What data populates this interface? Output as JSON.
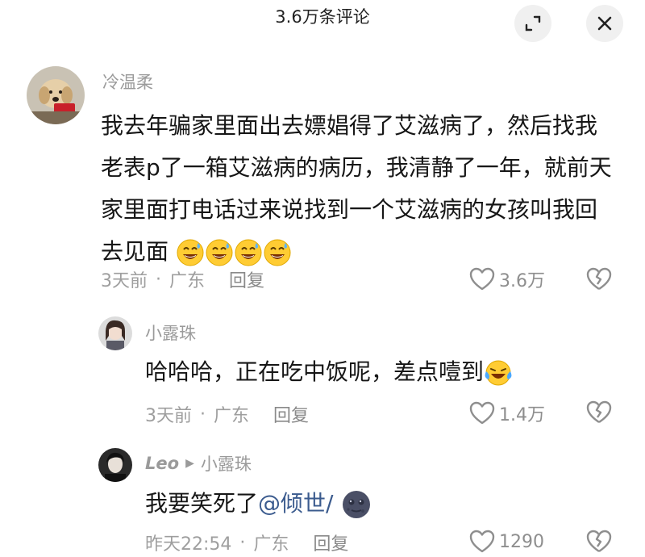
{
  "header": {
    "title": "3.6万条评论",
    "expand_icon": "expand-icon",
    "close_icon": "close-icon"
  },
  "comments": [
    {
      "username": "冷温柔",
      "text": "我去年骗家里面出去嫖娼得了艾滋病了，然后找我老表p了一箱艾滋病的病历，我清静了一年，就前天家里面打电话过来说找到一个艾滋病的女孩叫我回去见面",
      "emoji": "grinning-sweat-emoji x4",
      "time": "3天前",
      "dot": "·",
      "location": "广东",
      "reply_label": "回复",
      "likes": "3.6万"
    }
  ],
  "replies": [
    {
      "username": "小露珠",
      "text": "哈哈哈，正在吃中饭呢，差点噎到",
      "emoji": "crying-laughing-emoji",
      "time": "3天前",
      "dot": "·",
      "location": "广东",
      "reply_label": "回复",
      "likes": "1.4万"
    },
    {
      "username": "Leo",
      "reply_to": "小露珠",
      "arrow": "▶",
      "text": "我要笑死了",
      "mention": "@倾世/",
      "emoji": "dark-moon-face-emoji",
      "time": "昨天22:54",
      "dot": "·",
      "location": "广东",
      "reply_label": "回复",
      "likes": "1290"
    }
  ],
  "colors": {
    "username": "#9a9a9a",
    "meta": "#9e9e9e",
    "mention": "#3b5b8e",
    "text": "#161616"
  }
}
